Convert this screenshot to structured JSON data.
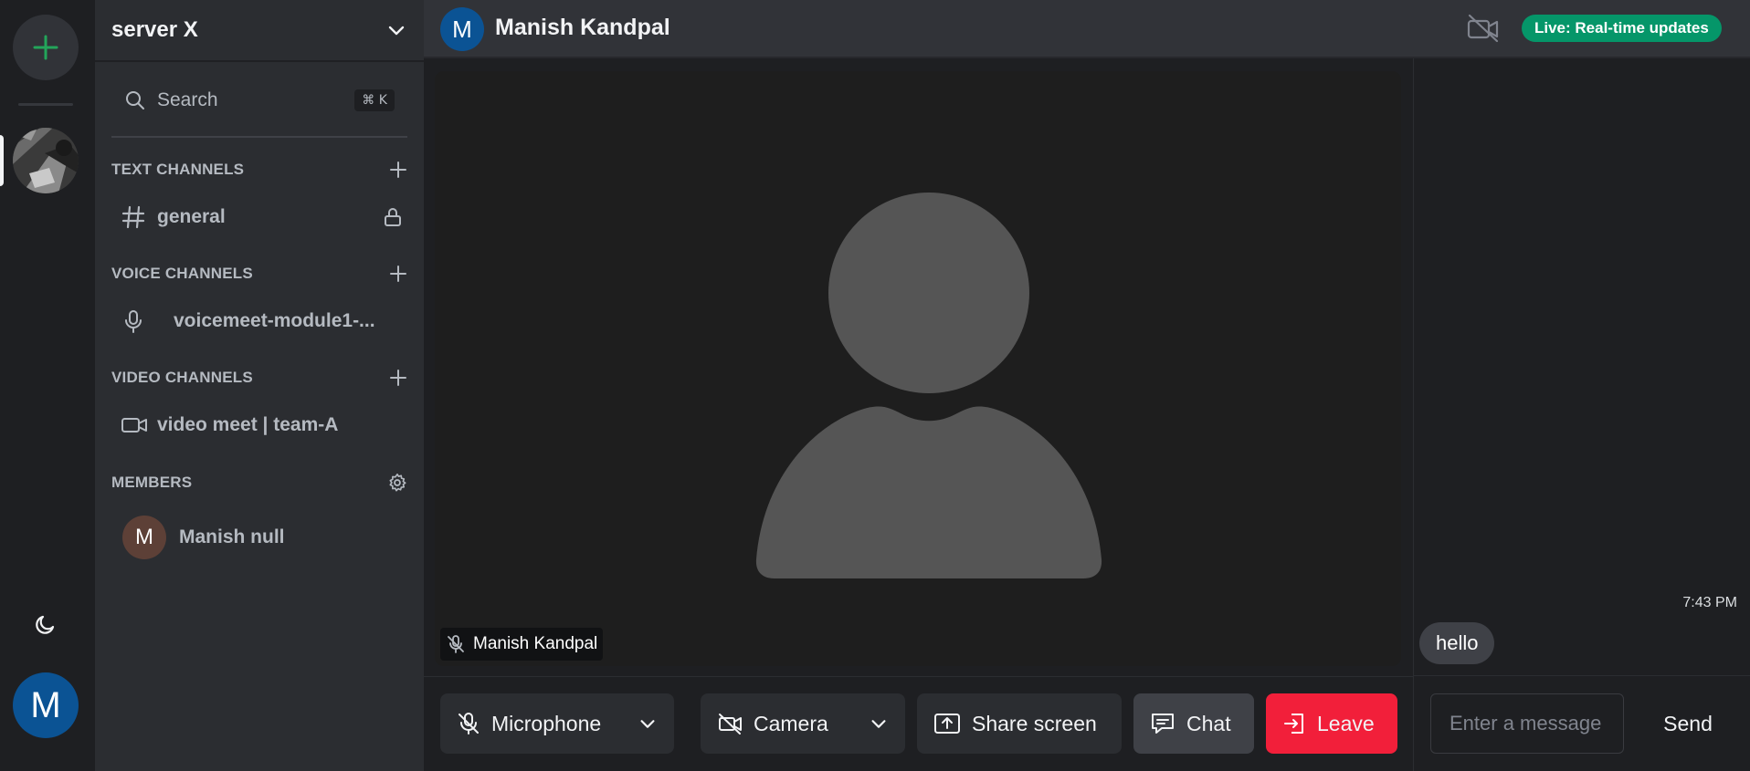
{
  "rail": {
    "add_server_icon": "plus-icon",
    "theme_icon": "moon-icon",
    "user_initial": "M",
    "accent": "#23a55a"
  },
  "sidebar": {
    "server_name": "server X",
    "search_label": "Search",
    "search_shortcut": "⌘ K",
    "sections": {
      "text": {
        "title": "TEXT CHANNELS",
        "channel": "general"
      },
      "voice": {
        "title": "VOICE CHANNELS",
        "channel": "voicemeet-module1-..."
      },
      "video": {
        "title": "VIDEO CHANNELS",
        "channel": "video meet | team-A"
      },
      "members": {
        "title": "MEMBERS",
        "member_initial": "M",
        "member_name": "Manish null"
      }
    }
  },
  "topbar": {
    "avatar_initial": "M",
    "name": "Manish Kandpal",
    "live_badge": "Live: Real-time updates",
    "live_color": "#059669"
  },
  "stage": {
    "participant_name": "Manish Kandpal"
  },
  "chat": {
    "time": "7:43 PM",
    "message": "hello",
    "input_placeholder": "Enter a message",
    "send_label": "Send"
  },
  "controls": {
    "microphone": "Microphone",
    "camera": "Camera",
    "share_screen": "Share screen",
    "chat": "Chat",
    "leave": "Leave",
    "leave_color": "#f21f3a"
  }
}
